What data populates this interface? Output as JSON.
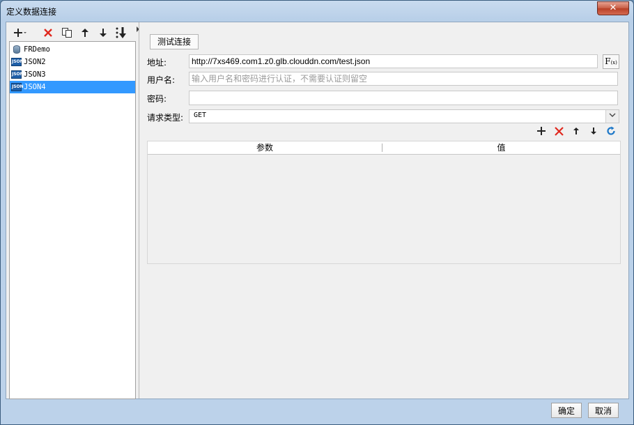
{
  "window": {
    "title": "定义数据连接",
    "close_glyph": "✕"
  },
  "left_toolbar": {
    "icons": [
      "add-icon",
      "delete-icon",
      "copy-icon",
      "move-up-icon",
      "move-down-icon",
      "sort-icon"
    ]
  },
  "connections": {
    "items": [
      {
        "label": "FRDemo",
        "icon": "database-icon",
        "selected": false
      },
      {
        "label": "JSON2",
        "icon": "json-icon",
        "selected": false
      },
      {
        "label": "JSON3",
        "icon": "json-icon",
        "selected": false
      },
      {
        "label": "JSON4",
        "icon": "json-icon",
        "selected": true
      }
    ],
    "json_badge": "JSON"
  },
  "form": {
    "test_button": "测试连接",
    "address_label": "地址:",
    "address_value": "http://7xs469.com1.z0.glb.clouddn.com/test.json",
    "formula_button": "F",
    "formula_sub": "(x)",
    "username_label": "用户名:",
    "username_placeholder": "输入用户名和密码进行认证，不需要认证则留空",
    "password_label": "密码:",
    "password_value": "",
    "request_type_label": "请求类型:",
    "request_type_value": "GET"
  },
  "params_toolbar": {
    "icons": [
      "add-icon",
      "delete-icon",
      "move-up-icon",
      "move-down-icon",
      "refresh-icon"
    ]
  },
  "params_table": {
    "columns": [
      "参数",
      "值"
    ],
    "rows": []
  },
  "footer": {
    "ok_label": "确定",
    "cancel_label": "取消"
  },
  "colors": {
    "selection": "#3399ff",
    "delete_red": "#e0281e",
    "refresh_blue": "#1e78c8",
    "title_bar": "#b8cfe8"
  }
}
